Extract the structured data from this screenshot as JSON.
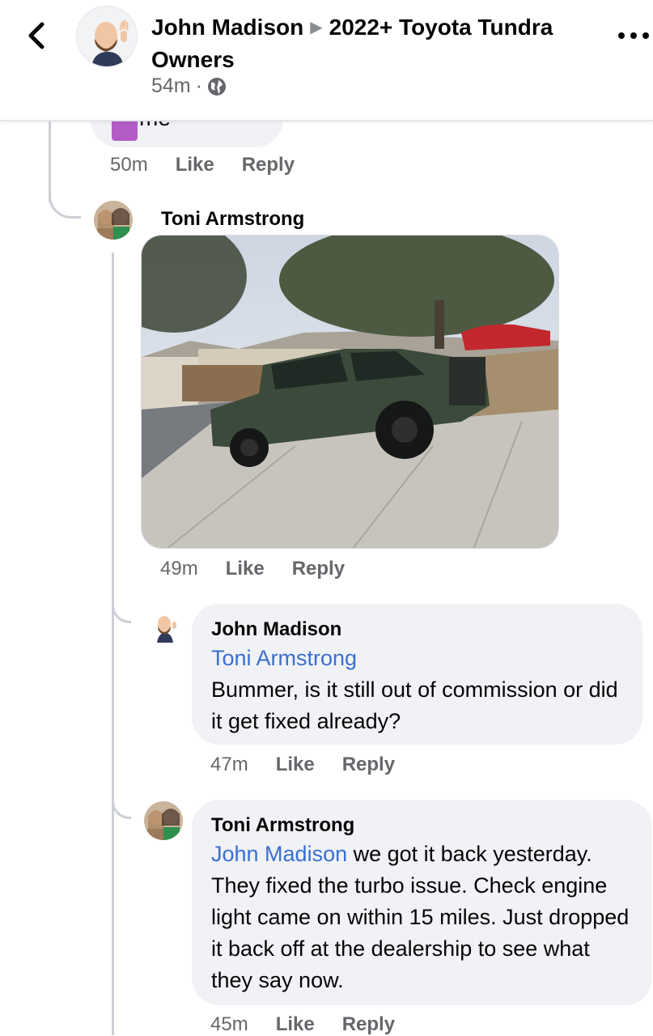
{
  "header": {
    "author": "John Madison",
    "group": "2022+ Toyota Tundra Owners",
    "time": "54m",
    "icons": {
      "back": "chevron-left-icon",
      "privacy": "globe-icon",
      "more": "more-dots-icon"
    }
  },
  "partial_comment": {
    "text": "me",
    "actions": {
      "time": "50m",
      "like": "Like",
      "reply": "Reply"
    }
  },
  "photo_comment": {
    "author": "Toni Armstrong",
    "actions": {
      "time": "49m",
      "like": "Like",
      "reply": "Reply"
    }
  },
  "replies": [
    {
      "author": "John Madison",
      "mention": "Toni Armstrong",
      "text": "Bummer, is it still out of commission or did it get fixed already?",
      "actions": {
        "time": "47m",
        "like": "Like",
        "reply": "Reply"
      }
    },
    {
      "author": "Toni Armstrong",
      "mention": "John Madison",
      "text": " we got it back yesterday. They fixed the turbo issue. Check engine light came on within 15 miles. Just dropped it back off at the dealership to see what they say now.",
      "actions": {
        "time": "45m",
        "like": "Like",
        "reply": "Reply"
      }
    }
  ],
  "colors": {
    "mention": "#3b6fcf",
    "bubble": "#f0f2f5",
    "meta": "#65676b",
    "thread_line": "#ccd0d5"
  }
}
